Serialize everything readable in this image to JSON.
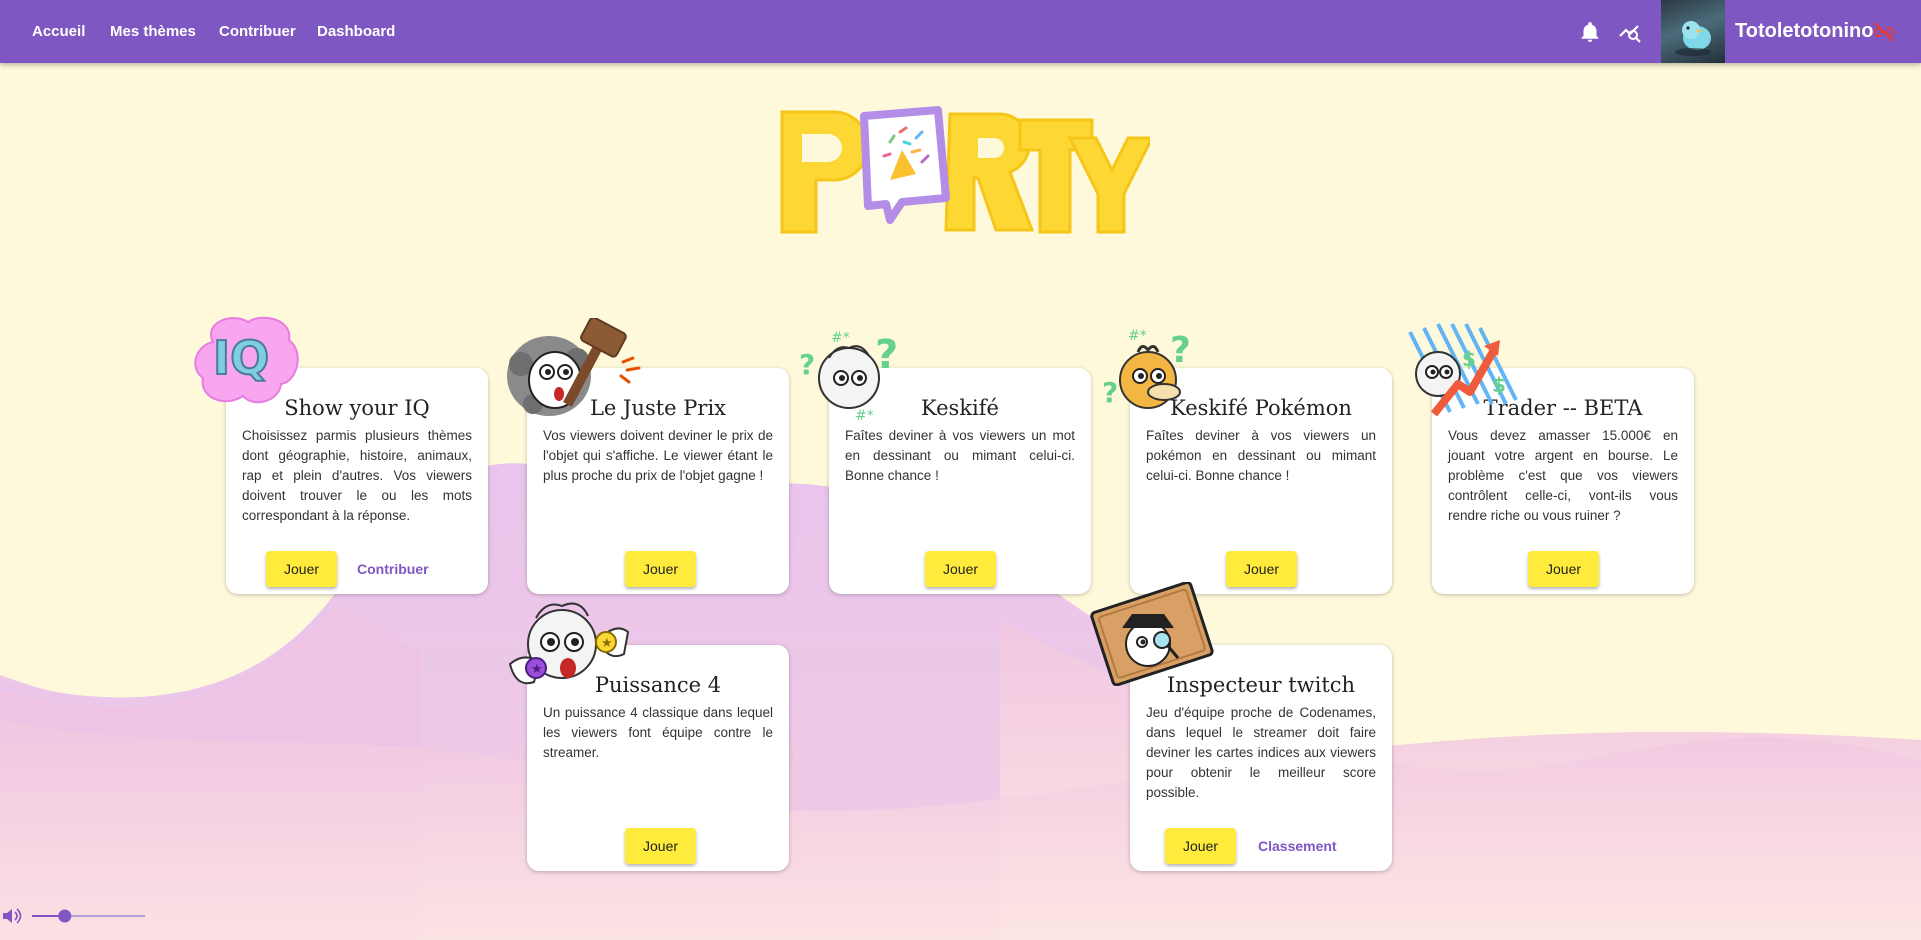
{
  "nav": {
    "links": [
      "Accueil",
      "Mes thèmes",
      "Contribuer",
      "Dashboard"
    ],
    "username": "Totoletotonino"
  },
  "colors": {
    "primary": "#7e57c2",
    "accent": "#ffeb3b",
    "background": "#fff9dc",
    "wave_front": "#f3c6df",
    "wave_back": "#e9c4ec",
    "danger": "#e53935"
  },
  "logo": {
    "alt": "PARTY"
  },
  "games": [
    {
      "title": "Show your IQ",
      "description": "Choisissez parmis plusieurs thèmes dont géographie, histoire, animaux, rap et plein d'autres. Vos viewers doivent trouver le ou les mots correspondant à la réponse.",
      "play_label": "Jouer",
      "secondary_label": "Contribuer"
    },
    {
      "title": "Le Juste Prix",
      "description": "Vos viewers doivent deviner le prix de l'objet qui s'affiche. Le viewer étant le plus proche du prix de l'objet gagne !",
      "play_label": "Jouer"
    },
    {
      "title": "Keskifé",
      "description": "Faîtes deviner à vos viewers un mot en dessinant ou mimant celui-ci. Bonne chance !",
      "play_label": "Jouer"
    },
    {
      "title": "Keskifé Pokémon",
      "description": "Faîtes deviner à vos viewers un pokémon en dessinant ou mimant celui-ci. Bonne chance !",
      "play_label": "Jouer"
    },
    {
      "title": "Trader -- BETA",
      "description": "Vous devez amasser 15.000€ en jouant votre argent en bourse. Le problème c'est que vos viewers contrôlent celle-ci, vont-ils vous rendre riche ou vous ruiner ?",
      "play_label": "Jouer"
    },
    {
      "title": "Puissance 4",
      "description": "Un puissance 4 classique dans lequel les viewers font équipe contre le streamer.",
      "play_label": "Jouer"
    },
    {
      "title": "Inspecteur twitch",
      "description": "Jeu d'équipe proche de Codenames, dans lequel le streamer doit faire deviner les cartes indices aux viewers pour obtenir le meilleur score possible.",
      "play_label": "Jouer",
      "secondary_label": "Classement"
    }
  ],
  "volume": {
    "level": 0.29
  }
}
